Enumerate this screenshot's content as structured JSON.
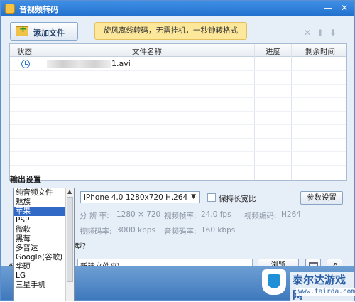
{
  "window": {
    "title": "音视频转码",
    "controls": [
      "—",
      "✕"
    ]
  },
  "toolbar": {
    "add_file_label": "添加文件",
    "promo_text": "旋风离线转码，无需挂机，一秒钟转格式",
    "icons": [
      "close-icon",
      "arrow-up-icon",
      "arrow-down-icon"
    ]
  },
  "file_table": {
    "columns": [
      "状态",
      "文件名称",
      "进度",
      "剩余时间"
    ],
    "rows": [
      {
        "status_icon": "clock-icon",
        "filename": "1.avi",
        "progress": "",
        "remaining": ""
      }
    ]
  },
  "output": {
    "section_label": "输出设置",
    "format_selected": "苹果",
    "device_selected": "iPhone 4.0 1280x720 H.264",
    "keep_aspect_label": "保持长宽比",
    "param_button": "参数设置",
    "params": {
      "resolution_label": "分 辨 率:",
      "resolution_value": "1280 × 720",
      "framerate_label": "视频帧率:",
      "framerate_value": "24.0 fps",
      "codec_label": "视频编码:",
      "codec_value": "H264",
      "video_bitrate_label": "视频码率:",
      "video_bitrate_value": "3000 kbps",
      "audio_bitrate_label": "音频码率:",
      "audio_bitrate_value": "160 kbps"
    },
    "hint_text": "型?",
    "path_label": "保",
    "path_value": "新建文件夹\\",
    "browse_button": "浏览",
    "ext_button": "↗"
  },
  "format_dropdown": {
    "options": [
      "纯音频文件",
      "魅族",
      "苹果",
      "PSP",
      "微软",
      "黑莓",
      "多普达",
      "Google(谷歌)",
      "华硕",
      "LG",
      "三星手机"
    ],
    "selected_index": 2
  },
  "watermark": {
    "brand": "泰尔达游戏网",
    "url": "www.tairda.com"
  },
  "colors": {
    "titlebar": "#2a78d6",
    "selection": "#3169c6",
    "promo_bg": "#fde79a"
  }
}
